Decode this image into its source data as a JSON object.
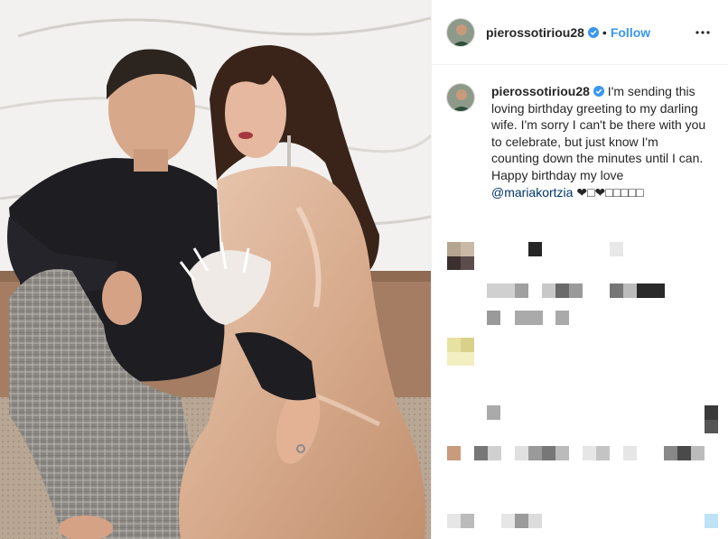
{
  "post": {
    "username": "pierossotiriou28",
    "follow_separator": "•",
    "follow_label": "Follow",
    "more_glyph": "•••",
    "caption": {
      "username": "pierossotiriou28",
      "text": " I'm sending this loving birthday greeting to my darling wife. I'm sorry I can't be there with you to celebrate, but just know I'm counting down the minutes until I can. Happy birthday my love ",
      "mention": "@mariakortzia",
      "emojis": " ❤□❤□□□□□"
    }
  },
  "colors": {
    "accent": "#3897f0",
    "verified": "#3897f0",
    "mention": "#003569",
    "text": "#262626",
    "border": "#efefef"
  },
  "icons": {
    "verified": "verified-badge-icon",
    "more": "more-options-icon"
  }
}
